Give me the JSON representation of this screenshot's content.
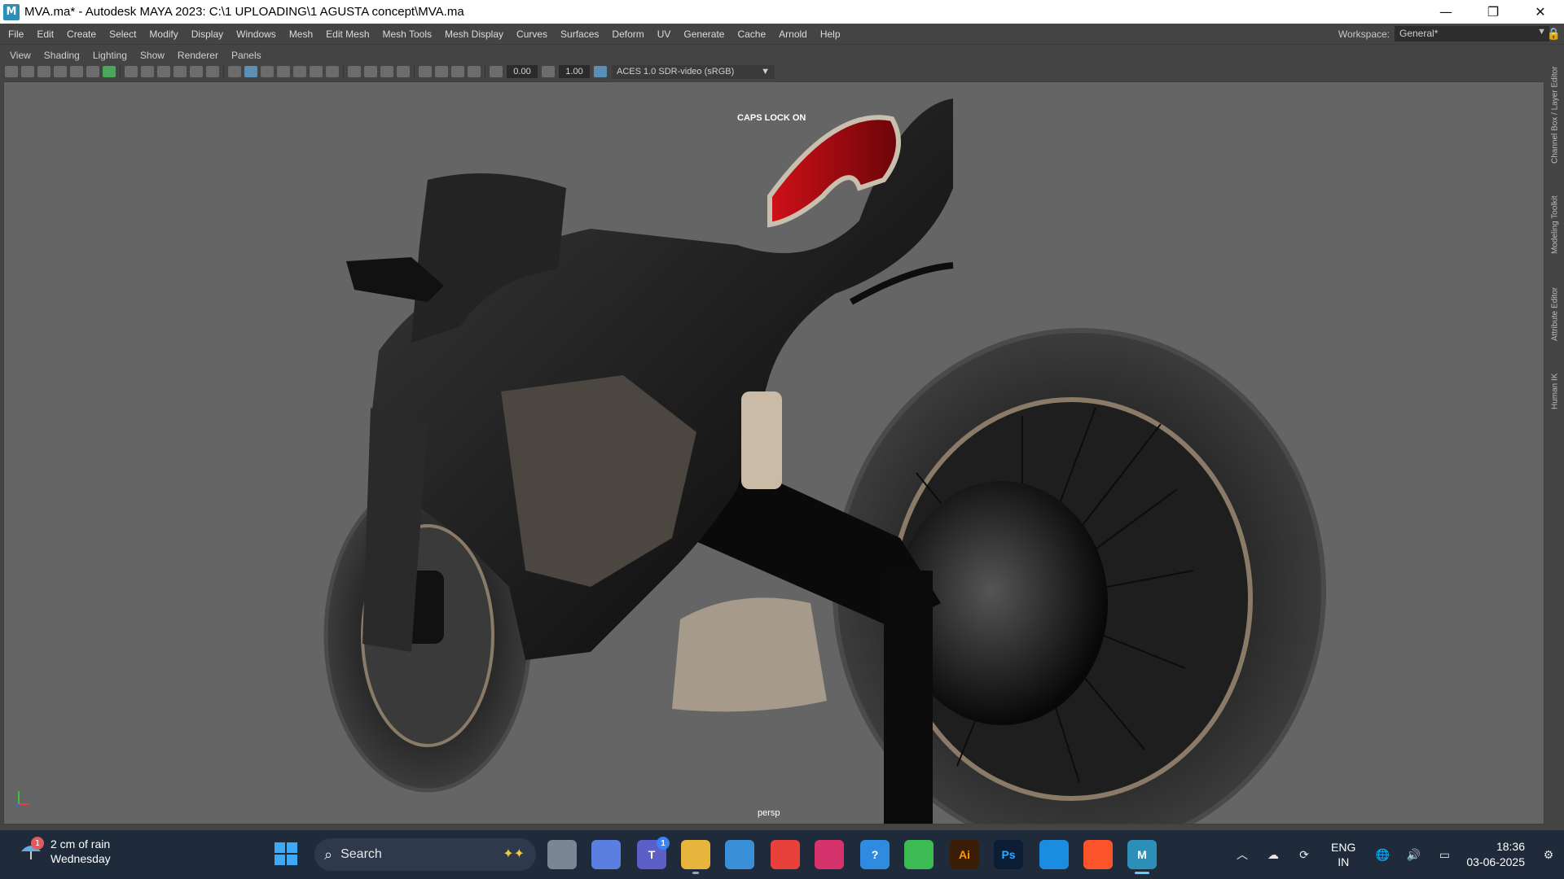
{
  "window": {
    "title": "MVA.ma* - Autodesk MAYA 2023: C:\\1 UPLOADING\\1 AGUSTA concept\\MVA.ma",
    "app_icon_letter": "M",
    "controls": {
      "minimize": "—",
      "restore": "❐",
      "close": "✕"
    }
  },
  "main_menu": [
    "File",
    "Edit",
    "Create",
    "Select",
    "Modify",
    "Display",
    "Windows",
    "Mesh",
    "Edit Mesh",
    "Mesh Tools",
    "Mesh Display",
    "Curves",
    "Surfaces",
    "Deform",
    "UV",
    "Generate",
    "Cache",
    "Arnold",
    "Help"
  ],
  "workspace": {
    "label": "Workspace:",
    "value": "General*"
  },
  "panel_menu": [
    "View",
    "Shading",
    "Lighting",
    "Show",
    "Renderer",
    "Panels"
  ],
  "viewport_toolbar": {
    "field_a": "0.00",
    "field_b": "1.00",
    "color_space": "ACES 1.0 SDR-video (sRGB)"
  },
  "viewport": {
    "caps_lock_message": "CAPS LOCK ON",
    "camera_label": "persp"
  },
  "side_tabs": [
    "Channel Box / Layer Editor",
    "Modeling Toolkit",
    "Attribute Editor",
    "Human IK"
  ],
  "taskbar": {
    "weather": {
      "line1": "2 cm of rain",
      "line2": "Wednesday",
      "badge": "1"
    },
    "search_placeholder": "Search",
    "apps": [
      {
        "name": "task-view",
        "label": "",
        "color": "#7a8694"
      },
      {
        "name": "copilot",
        "label": "",
        "color": "#5a7fe0"
      },
      {
        "name": "teams",
        "label": "T",
        "color": "#5b5fc7",
        "badge": "1"
      },
      {
        "name": "file-explorer",
        "label": "",
        "color": "#e8b53c"
      },
      {
        "name": "microsoft-store",
        "label": "",
        "color": "#3a8fd9"
      },
      {
        "name": "anydesk",
        "label": "",
        "color": "#e8403a"
      },
      {
        "name": "forza",
        "label": "",
        "color": "#d6336c"
      },
      {
        "name": "help",
        "label": "?",
        "color": "#2f8be0"
      },
      {
        "name": "chrome",
        "label": "",
        "color": "#3cba54"
      },
      {
        "name": "illustrator",
        "label": "Ai",
        "color": "#3b1d05"
      },
      {
        "name": "photoshop",
        "label": "Ps",
        "color": "#0b1e36"
      },
      {
        "name": "edge",
        "label": "",
        "color": "#1b8de0"
      },
      {
        "name": "brave",
        "label": "",
        "color": "#fb542b"
      },
      {
        "name": "maya",
        "label": "M",
        "color": "#2b8fb8"
      }
    ],
    "language": {
      "line1": "ENG",
      "line2": "IN"
    },
    "clock": {
      "time": "18:36",
      "date": "03-06-2025"
    }
  }
}
